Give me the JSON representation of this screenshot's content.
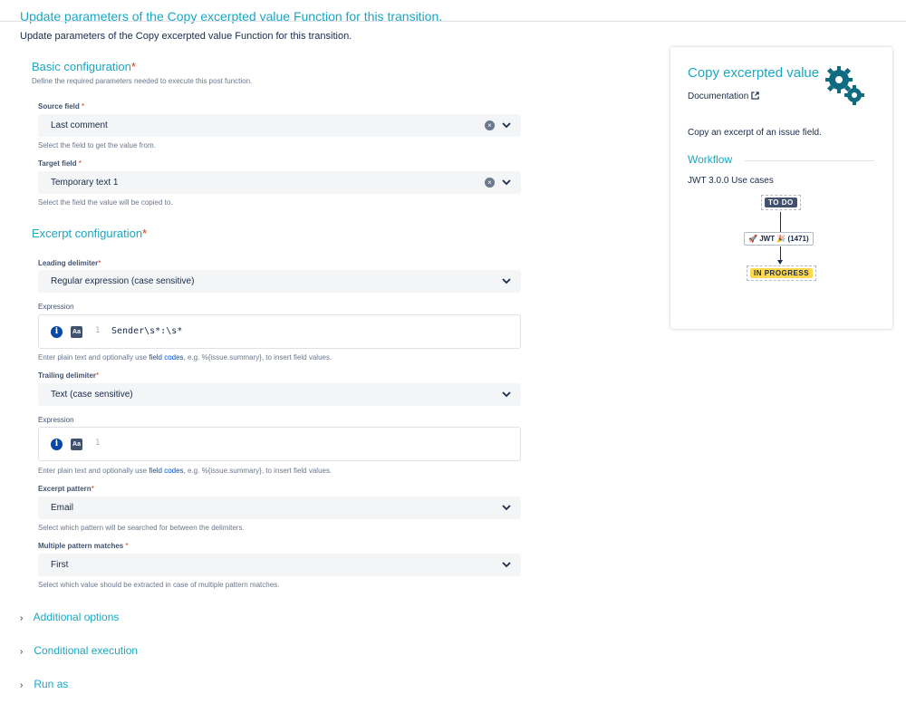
{
  "header": {
    "title": "Update parameters of the Copy excerpted value Function for this transition.",
    "subtitle": "Update parameters of the Copy excerpted value Function for this transition."
  },
  "basic": {
    "title": "Basic configuration",
    "required_mark": "*",
    "description": "Define the required parameters needed to execute this post function.",
    "source": {
      "label": "Source field",
      "value": "Last comment",
      "help": "Select the field to get the value from."
    },
    "target": {
      "label": "Target field",
      "value": "Temporary text 1",
      "help": "Select the field the value will be copied to."
    }
  },
  "excerpt": {
    "title": "Excerpt configuration",
    "leading": {
      "label": "Leading delimiter",
      "value": "Regular expression (case sensitive)"
    },
    "expr1": {
      "label": "Expression",
      "line_no": "1",
      "code": "Sender\\s*:\\s*",
      "help_pre": "Enter plain text and optionally use ",
      "help_link": "field codes",
      "help_post": ", e.g. %{issue.summary}, to insert field values."
    },
    "trailing": {
      "label": "Trailing delimiter",
      "value": "Text (case sensitive)"
    },
    "expr2": {
      "label": "Expression",
      "line_no": "1",
      "code": "",
      "help_pre": "Enter plain text and optionally use ",
      "help_link": "field codes",
      "help_post": ", e.g. %{issue.summary}, to insert field values."
    },
    "pattern": {
      "label": "Excerpt pattern",
      "value": "Email",
      "help": "Select which pattern will be searched for between the delimiters."
    },
    "multi": {
      "label": "Multiple pattern matches",
      "value": "First",
      "help": "Select which value should be extracted in case of multiple pattern matches."
    }
  },
  "collapsibles": {
    "additional": "Additional options",
    "conditional": "Conditional execution",
    "run_as": "Run as"
  },
  "panel": {
    "title": "Copy excerpted value",
    "doc_link": "Documentation",
    "description": "Copy an excerpt of an issue field.",
    "workflow_title": "Workflow",
    "workflow_case": "JWT 3.0.0 Use cases",
    "status_from": "TO DO",
    "transition": "JWT",
    "transition_count": "(1471)",
    "status_to": "IN PROGRESS"
  },
  "colors": {
    "accent": "#1aa7c4",
    "required": "#de350b",
    "link": "#0052cc",
    "todo": "#42526e",
    "in_progress": "#ffd84d"
  }
}
